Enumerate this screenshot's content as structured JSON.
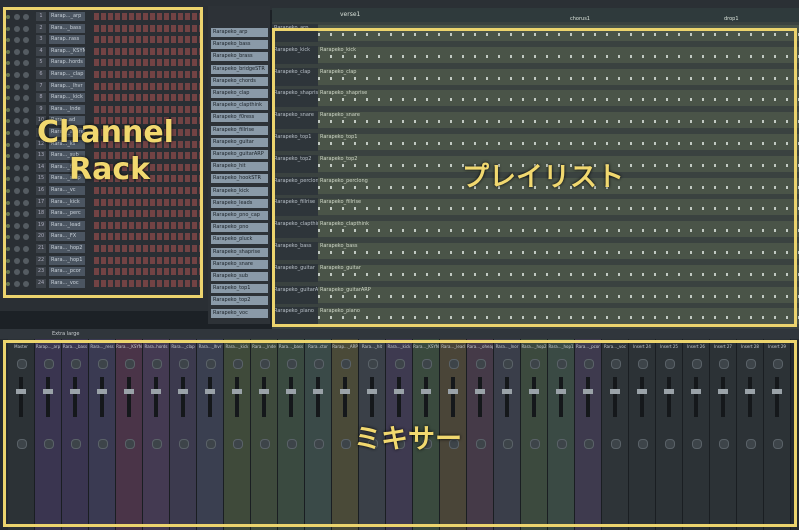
{
  "labels": {
    "channel_rack_line1": "Channel",
    "channel_rack_line2": "Rack",
    "playlist": "プレイリスト",
    "mixer": "ミキサー"
  },
  "mixer_toolbar": {
    "size_label": "Extra large"
  },
  "playlist_ruler": {
    "pattern_name": "verse1",
    "marker1": "chorus1",
    "marker2": "drop1"
  },
  "channels": [
    {
      "num": "1",
      "name": "Rarap..._arp"
    },
    {
      "num": "2",
      "name": "Rara..._bass"
    },
    {
      "num": "3",
      "name": "Rarap..rass"
    },
    {
      "num": "4",
      "name": "Rarap..._KSYN"
    },
    {
      "num": "5",
      "name": "Rarap..hords"
    },
    {
      "num": "6",
      "name": "Rarap..._clap"
    },
    {
      "num": "7",
      "name": "Rarap..._lhvr"
    },
    {
      "num": "8",
      "name": "Rarap..._kick"
    },
    {
      "num": "9",
      "name": "Rara..._lnde"
    },
    {
      "num": "10",
      "name": "Rarap..ad"
    },
    {
      "num": "11",
      "name": "Rara..._snare"
    },
    {
      "num": "12",
      "name": "Rara..._ks"
    },
    {
      "num": "13",
      "name": "Rara..._sub"
    },
    {
      "num": "14",
      "name": "Rara..._fx"
    },
    {
      "num": "15",
      "name": "Rara..._stop"
    },
    {
      "num": "16",
      "name": "Rara..._vc"
    },
    {
      "num": "17",
      "name": "Rara..._kick"
    },
    {
      "num": "18",
      "name": "Rara..._perc"
    },
    {
      "num": "19",
      "name": "Rara..._lead"
    },
    {
      "num": "20",
      "name": "Rara..._FX"
    },
    {
      "num": "21",
      "name": "Rara..._hop2"
    },
    {
      "num": "22",
      "name": "Rara..._hop1"
    },
    {
      "num": "23",
      "name": "Rara..._pcor"
    },
    {
      "num": "24",
      "name": "Rara..._voc"
    }
  ],
  "patterns": [
    "Rarapeko_arp",
    "Rarapeko_bass",
    "Rarapeko_brass",
    "Rarapeko_bridgeSTR",
    "Rarapeko_chords",
    "Rarapeko_clap",
    "Rarapeko_clapthink",
    "Rarapeko_f0ress",
    "Rarapeko_fillrise",
    "Rarapeko_guitar",
    "Rarapeko_guitarARP",
    "Rarapeko_hit",
    "Rarapeko_hookSTR",
    "Rarapeko_kick",
    "Rarapeko_leads",
    "Rarapeko_pno_cap",
    "Rarapeko_pno",
    "Rarapeko_pluck",
    "Rarapeko_shaprise",
    "Rarapeko_snare",
    "Rarapeko_sub",
    "Rarapeko_top1",
    "Rarapeko_top2",
    "Rarapeko_voc"
  ],
  "tracks": [
    {
      "label": "Rarapeko_arp",
      "clip": ""
    },
    {
      "label": "Rarapeko_kick",
      "clip": "Rarapeko_kick"
    },
    {
      "label": "Rarapeko_clap",
      "clip": "Rarapeko_clap"
    },
    {
      "label": "Rarapeko_shaprise",
      "clip": "Rarapeko_shaprise"
    },
    {
      "label": "Rarapeko_snare",
      "clip": "Rarapeko_snare"
    },
    {
      "label": "Rarapeko_top1",
      "clip": "Rarapeko_top1"
    },
    {
      "label": "Rarapeko_top2",
      "clip": "Rarapeko_top2"
    },
    {
      "label": "Rarapeko_perclong",
      "clip": "Rarapeko_perclong"
    },
    {
      "label": "Rarapeko_fillrise",
      "clip": "Rarapeko_fillrise"
    },
    {
      "label": "Rarapeko_clapthink",
      "clip": "Rarapeko_clapthink"
    },
    {
      "label": "Rarapeko_bass",
      "clip": "Rarapeko_bass"
    },
    {
      "label": "Rarapeko_guitar",
      "clip": "Rarapeko_guitar"
    },
    {
      "label": "Rarapeko_guitarARP",
      "clip": "Rarapeko_guitarARP"
    },
    {
      "label": "Rarapeko_piano",
      "clip": "Rarapeko_piano"
    }
  ],
  "mixer_strips": [
    "Master",
    "Rarap..._arp",
    "Rara..._bass",
    "Rara..._ress",
    "Rara..._KSYN",
    "Rara..hords",
    "Rara..._clap",
    "Rara..._lhvr",
    "Rara..._kick",
    "Rara..._lnde",
    "Rara..._bass",
    "Rara..ctor",
    "Rarap..._ARP",
    "Rara..._hit",
    "Rara..._kick",
    "Rara..._KSYN",
    "Rara..._lead",
    "Rara..._oheap",
    "Rara..._lnor",
    "Rara..._hop2",
    "Rara..._hop1",
    "Rara..._pcor",
    "Rara..._voc",
    "Insert 24",
    "Insert 25",
    "Insert 26",
    "Insert 27",
    "Insert 28",
    "Insert 29"
  ],
  "colors": {
    "highlight": "#ecd46e",
    "clip_green": "#4a5448",
    "mixer_bg": "#252a2f"
  }
}
